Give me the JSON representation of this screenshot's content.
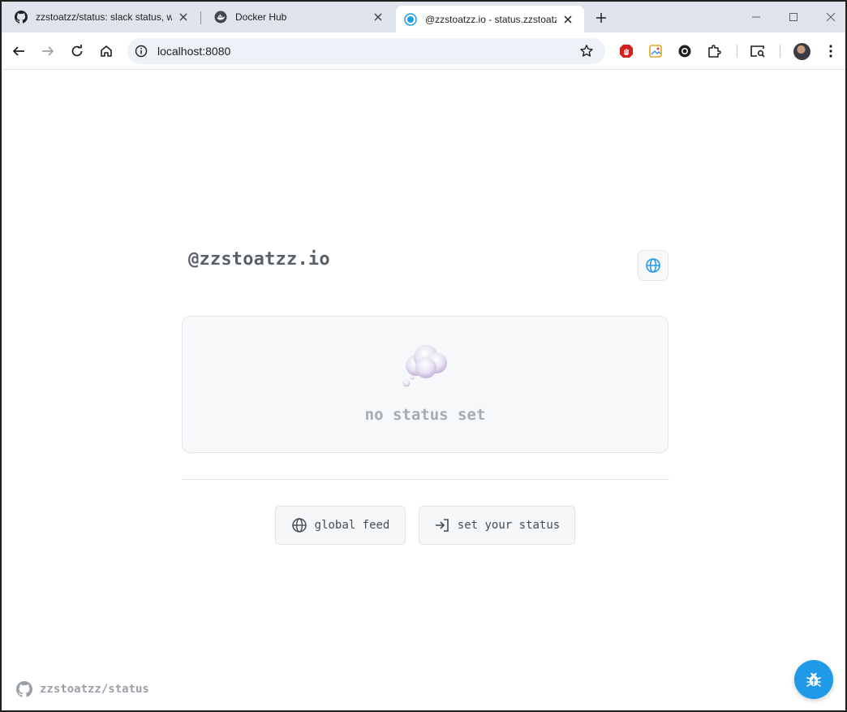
{
  "browser": {
    "tabs": [
      {
        "title": "zzstoatzz/status: slack status, w",
        "favicon": "github-icon",
        "active": false
      },
      {
        "title": "Docker Hub",
        "favicon": "docker-icon",
        "active": false
      },
      {
        "title": "@zzstoatzz.io - status.zzstoatzz",
        "favicon": "status-site-icon",
        "active": true
      }
    ],
    "address": {
      "url": "localhost:8080"
    }
  },
  "page": {
    "handle": "@zzstoatzz.io",
    "status": {
      "text": "no status set",
      "emoji": "thought-balloon"
    },
    "actions": {
      "global_feed": "global feed",
      "set_status": "set your status"
    },
    "footer": {
      "repo": "zzstoatzz/status"
    }
  },
  "colors": {
    "accent": "#1f9ae6",
    "handle": "#586069",
    "muted": "#a5abb3"
  }
}
